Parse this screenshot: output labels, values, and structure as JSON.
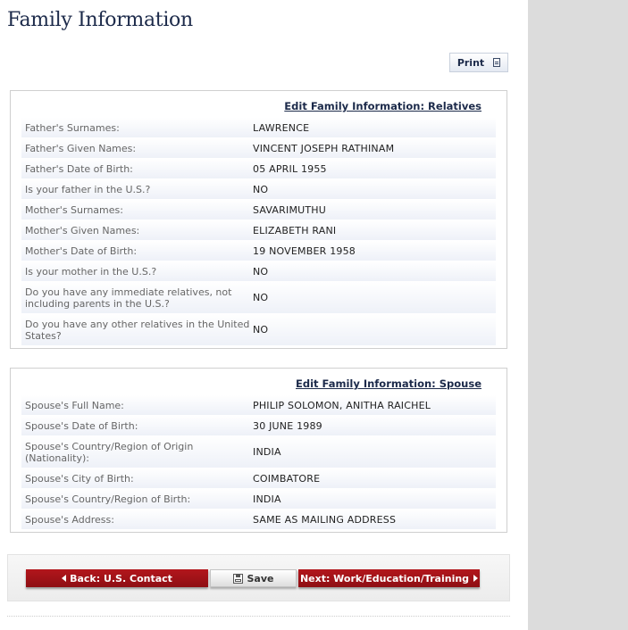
{
  "page": {
    "title": "Family Information"
  },
  "print": {
    "label": "Print",
    "icon": "document-icon"
  },
  "relatives": {
    "edit_link": "Edit Family Information: Relatives",
    "rows": [
      {
        "label": "Father's Surnames:",
        "value": "LAWRENCE"
      },
      {
        "label": "Father's Given Names:",
        "value": "VINCENT JOSEPH RATHINAM"
      },
      {
        "label": "Father's Date of Birth:",
        "value": "05 APRIL 1955"
      },
      {
        "label": "Is your father in the U.S.?",
        "value": "NO"
      },
      {
        "label": "Mother's Surnames:",
        "value": "SAVARIMUTHU"
      },
      {
        "label": "Mother's Given Names:",
        "value": "ELIZABETH RANI"
      },
      {
        "label": "Mother's Date of Birth:",
        "value": "19 NOVEMBER 1958"
      },
      {
        "label": "Is your mother in the U.S.?",
        "value": "NO"
      },
      {
        "label": "Do you have any immediate relatives, not including parents in the U.S.?",
        "value": "NO"
      },
      {
        "label": "Do you have any other relatives in the United States?",
        "value": "NO"
      }
    ]
  },
  "spouse": {
    "edit_link": "Edit Family Information: Spouse",
    "rows": [
      {
        "label": "Spouse's Full Name:",
        "value": "PHILIP SOLOMON, ANITHA RAICHEL"
      },
      {
        "label": "Spouse's Date of Birth:",
        "value": "30 JUNE 1989"
      },
      {
        "label": "Spouse's Country/Region of Origin (Nationality):",
        "value": "INDIA"
      },
      {
        "label": "Spouse's City of Birth:",
        "value": "COIMBATORE"
      },
      {
        "label": "Spouse's Country/Region of Birth:",
        "value": "INDIA"
      },
      {
        "label": "Spouse's Address:",
        "value": "SAME AS MAILING ADDRESS"
      }
    ]
  },
  "nav": {
    "back_label": "Back: U.S. Contact",
    "save_label": "Save",
    "next_label": "Next: Work/Education/Training"
  },
  "colors": {
    "accent_red": "#a01218",
    "title_navy": "#1c2a4a",
    "gutter_grey": "#dcdcdc"
  }
}
